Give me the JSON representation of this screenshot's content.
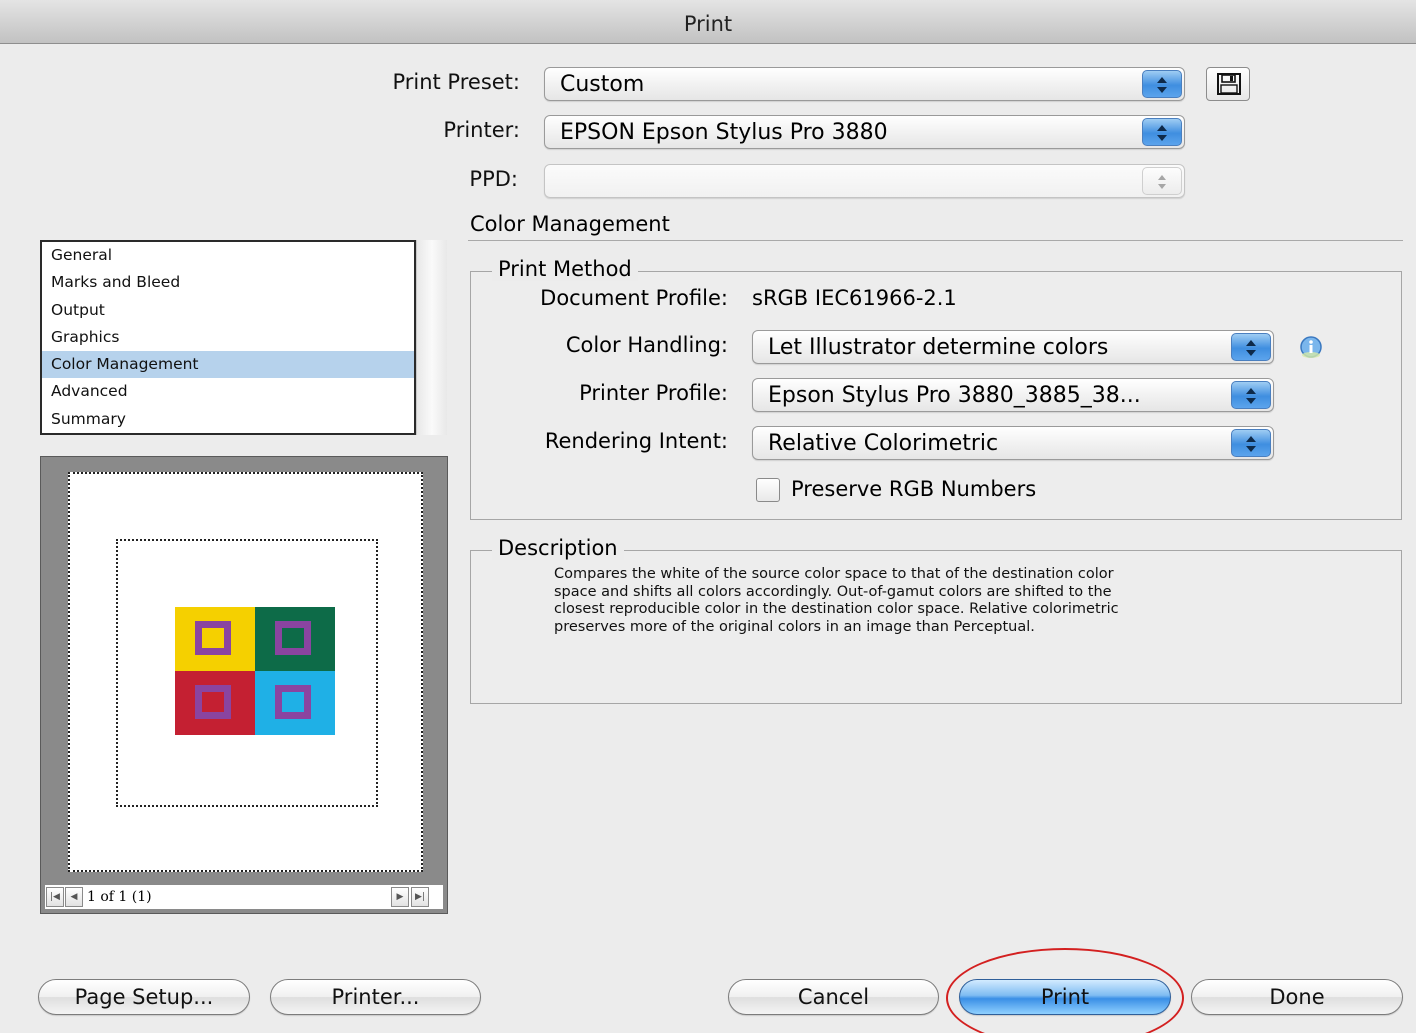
{
  "window": {
    "title": "Print"
  },
  "preset": {
    "label": "Print Preset:",
    "value": "Custom"
  },
  "printer": {
    "label": "Printer:",
    "value": "EPSON Epson Stylus Pro 3880"
  },
  "ppd": {
    "label": "PPD:",
    "value": ""
  },
  "section": {
    "title": "Color Management"
  },
  "categories": {
    "items": [
      "General",
      "Marks and Bleed",
      "Output",
      "Graphics",
      "Color Management",
      "Advanced",
      "Summary"
    ],
    "selected": "Color Management"
  },
  "print_method": {
    "legend": "Print Method",
    "document_profile_label": "Document Profile:",
    "document_profile_value": "sRGB IEC61966-2.1",
    "color_handling_label": "Color Handling:",
    "color_handling_value": "Let Illustrator determine colors",
    "printer_profile_label": "Printer Profile:",
    "printer_profile_value": "Epson Stylus Pro 3880_3885_38...",
    "rendering_intent_label": "Rendering Intent:",
    "rendering_intent_value": "Relative Colorimetric",
    "preserve_rgb_label": "Preserve RGB Numbers",
    "preserve_rgb_checked": false
  },
  "description": {
    "legend": "Description",
    "lines": [
      "Compares the white of the source color space to that of the destination color",
      "space and shifts all colors accordingly. Out-of-gamut colors are shifted to the",
      "closest reproducible color in the destination color space. Relative colorimetric",
      "preserves more of the original colors in an image than Perceptual."
    ]
  },
  "preview": {
    "page_indicator": "1 of 1 (1)",
    "swatch_colors": [
      "#f5d000",
      "#0d6b48",
      "#c42032",
      "#1fb0e6"
    ],
    "inner_square_color": "#8a44a0"
  },
  "buttons": {
    "page_setup": "Page Setup...",
    "printer": "Printer...",
    "cancel": "Cancel",
    "print": "Print",
    "done": "Done"
  },
  "colors": {
    "accent": "#3a8fe6",
    "highlight_ring": "#d32020",
    "selection": "#b6d2ec"
  }
}
